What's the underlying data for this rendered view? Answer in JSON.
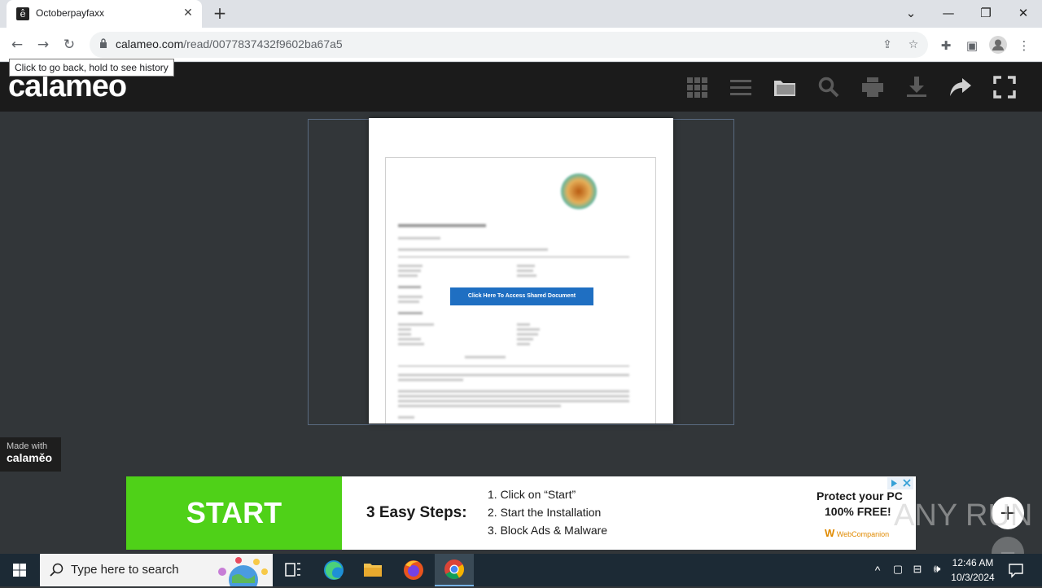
{
  "browser": {
    "tab_title": "Octoberpayfaxx",
    "tab_favicon": "e-calameo-favicon",
    "new_tab_icon": "plus-icon",
    "url_host": "calameo.com",
    "url_path": "/read/0077837432f9602ba67a5",
    "tooltip": "Click to go back, hold to see history"
  },
  "calameo": {
    "logo": "calameo",
    "toolbar_icons": [
      "grid-view-icon",
      "list-view-icon",
      "folder-icon",
      "search-icon",
      "print-icon",
      "download-icon",
      "share-icon",
      "fullscreen-icon"
    ],
    "document_button": "Click Here To Access Shared Document",
    "made_with_line1": "Made with",
    "made_with_line2": "calaměo"
  },
  "ad": {
    "start": "START",
    "steps_title": "3 Easy Steps:",
    "steps": [
      "1. Click on “Start”",
      "2. Start the Installation",
      "3. Block Ads & Malware"
    ],
    "protect": "Protect your PC",
    "free": "100% FREE!",
    "brand": "WebCompanion"
  },
  "watermark": "ANY RUN",
  "taskbar": {
    "search_placeholder": "Type here to search",
    "time": "12:46 AM",
    "date": "10/3/2024"
  },
  "colors": {
    "ad_green": "#4fd118",
    "doc_button_blue": "#1f6fc2",
    "calameo_header": "#1b1b1b",
    "viewer_bg": "#323639"
  }
}
